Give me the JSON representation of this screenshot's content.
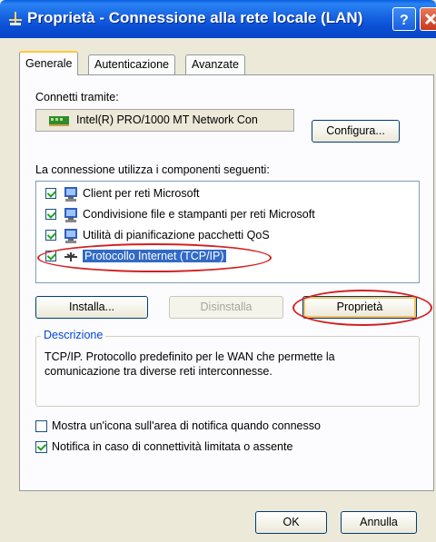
{
  "window": {
    "title": "Proprietà - Connessione alla rete locale (LAN)",
    "help_icon": "question-mark",
    "close_icon": "x"
  },
  "tabs": [
    {
      "label": "Generale",
      "active": true
    },
    {
      "label": "Autenticazione",
      "active": false
    },
    {
      "label": "Avanzate",
      "active": false
    }
  ],
  "connect": {
    "label": "Connetti tramite:",
    "adapter": "Intel(R) PRO/1000 MT Network Con",
    "configure_label": "Configura..."
  },
  "components": {
    "label": "La connessione utilizza i componenti seguenti:",
    "items": [
      {
        "label": "Client per reti Microsoft",
        "checked": true,
        "icon": "network-client-icon"
      },
      {
        "label": "Condivisione file e stampanti per reti Microsoft",
        "checked": true,
        "icon": "file-printer-sharing-icon"
      },
      {
        "label": "Utilità di pianificazione pacchetti QoS",
        "checked": true,
        "icon": "qos-scheduler-icon"
      },
      {
        "label": "Protocollo Internet (TCP/IP)",
        "checked": true,
        "selected": true,
        "icon": "protocol-icon"
      }
    ]
  },
  "actions": {
    "install": "Installa...",
    "uninstall": "Disinstalla",
    "properties": "Proprietà"
  },
  "description": {
    "legend": "Descrizione",
    "text": "TCP/IP. Protocollo predefinito per le WAN che permette la comunicazione tra diverse reti interconnesse."
  },
  "options": {
    "show_icon": {
      "label": "Mostra un'icona sull'area di notifica quando connesso",
      "checked": false
    },
    "notify_limited": {
      "label": "Notifica in caso di connettività limitata o assente",
      "checked": true
    }
  },
  "footer": {
    "ok": "OK",
    "cancel": "Annulla"
  },
  "colors": {
    "titlebar": "#0a4fd4",
    "selection": "#316ac5",
    "annotation": "#d32020"
  }
}
